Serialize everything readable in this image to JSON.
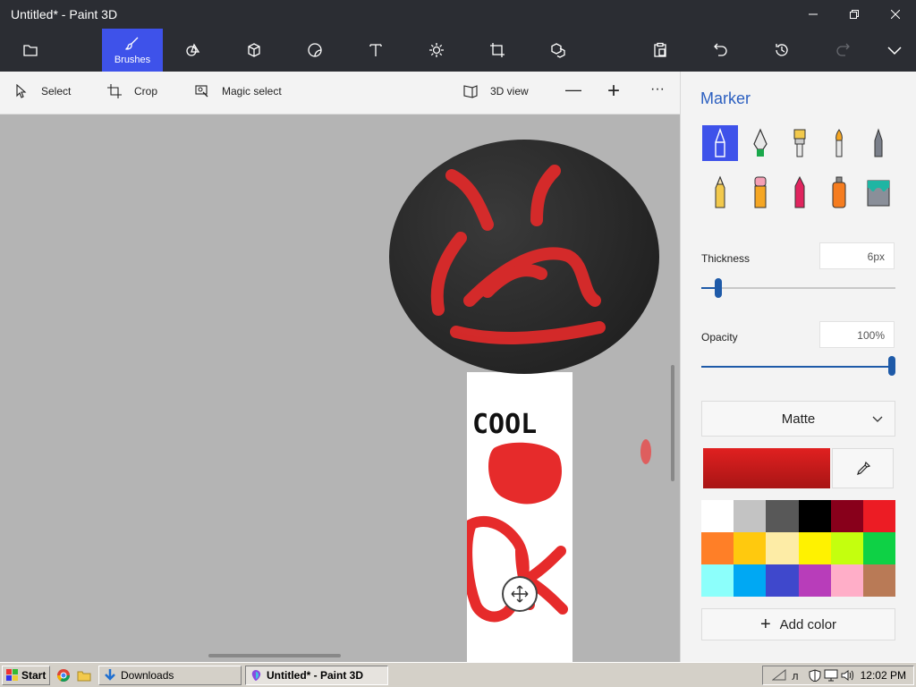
{
  "window": {
    "title": "Untitled* - Paint 3D",
    "controls": [
      "minimize-icon",
      "restore-icon",
      "close-icon"
    ]
  },
  "ribbon": {
    "items": [
      {
        "name": "menu",
        "icon": "folder-icon",
        "label": ""
      },
      {
        "name": "brushes",
        "icon": "brush-icon",
        "label": "Brushes",
        "active": true
      },
      {
        "name": "2d-shapes",
        "icon": "shapes-2d-icon",
        "label": ""
      },
      {
        "name": "3d-shapes",
        "icon": "cube-icon",
        "label": ""
      },
      {
        "name": "stickers",
        "icon": "sticker-icon",
        "label": ""
      },
      {
        "name": "text",
        "icon": "text-icon",
        "label": ""
      },
      {
        "name": "effects",
        "icon": "sun-icon",
        "label": ""
      },
      {
        "name": "canvas",
        "icon": "canvas-icon",
        "label": ""
      },
      {
        "name": "3d-library",
        "icon": "3d-library-icon",
        "label": ""
      },
      {
        "name": "paste",
        "icon": "clipboard-icon",
        "label": ""
      },
      {
        "name": "undo",
        "icon": "undo-icon",
        "label": ""
      },
      {
        "name": "history",
        "icon": "history-icon",
        "label": ""
      },
      {
        "name": "redo",
        "icon": "redo-icon",
        "label": ""
      },
      {
        "name": "expand",
        "icon": "chevron-down-icon",
        "label": ""
      }
    ]
  },
  "toolbar": {
    "select": "Select",
    "crop": "Crop",
    "magic_select": "Magic select",
    "view_3d": "3D view",
    "zoom_out": "—",
    "zoom_in": "+",
    "more": "···"
  },
  "canvas": {
    "text_on_canvas": "COOL"
  },
  "panel": {
    "title": "Marker",
    "brushes": [
      "marker",
      "calligraphy-pen",
      "oil-brush",
      "watercolor",
      "pixel-pen",
      "pencil",
      "eraser",
      "crayon",
      "spray-can",
      "fill"
    ],
    "thickness_label": "Thickness",
    "thickness_value": "6px",
    "thickness_fraction": 0.07,
    "opacity_label": "Opacity",
    "opacity_value": "100%",
    "opacity_fraction": 1.0,
    "finish": "Matte",
    "current_color": "#e02020",
    "palette": [
      "#ffffff",
      "#c3c3c3",
      "#585858",
      "#000000",
      "#88001b",
      "#ec1c24",
      "#ff7f27",
      "#ffc90e",
      "#fdeca6",
      "#fff200",
      "#c4ff0e",
      "#0ed145",
      "#8cfffb",
      "#00a8f3",
      "#3f48cc",
      "#b83dba",
      "#ffaec8",
      "#b97a56"
    ],
    "add_color": "Add color"
  },
  "taskbar": {
    "start": "Start",
    "downloads": "Downloads",
    "active_app": "Untitled* - Paint 3D",
    "time": "12:02 PM"
  }
}
